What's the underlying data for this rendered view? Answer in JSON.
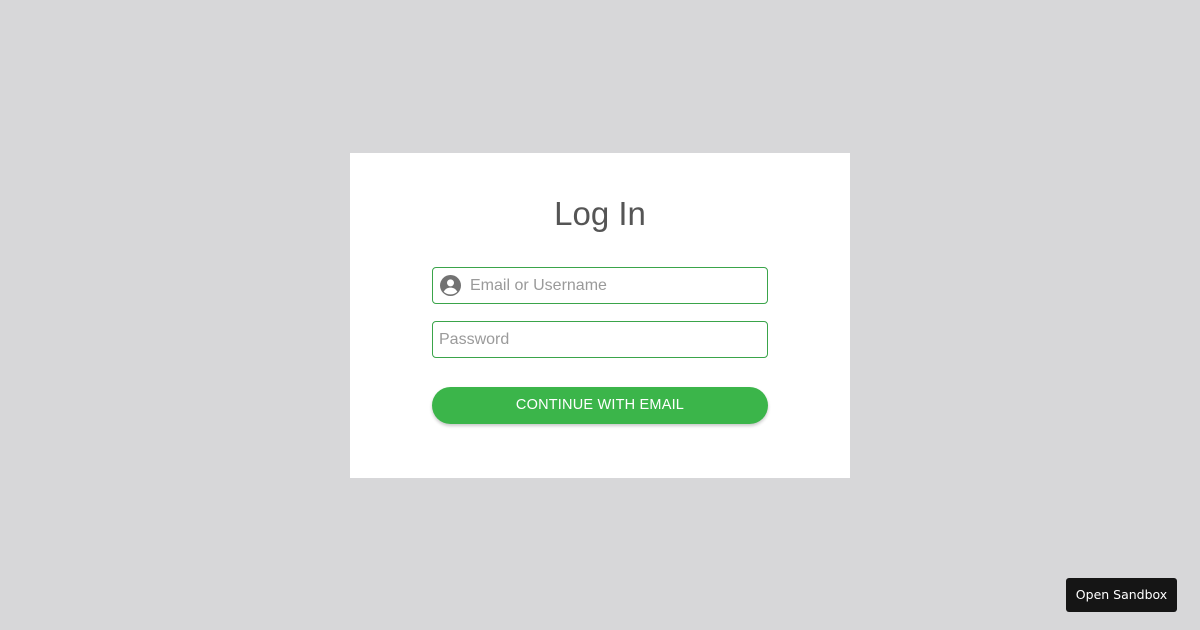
{
  "login": {
    "title": "Log In",
    "username_placeholder": "Email or Username",
    "username_value": "",
    "username_icon": "user-circle-icon",
    "password_placeholder": "Password",
    "password_value": "",
    "continue_label": "CONTINUE WITH EMAIL"
  },
  "sandbox": {
    "label": "Open Sandbox"
  },
  "colors": {
    "background": "#d7d7d9",
    "card": "#ffffff",
    "accent": "#3bb54a",
    "field_border": "#3aa44a",
    "title": "#555555",
    "sandbox_button": "#151515"
  }
}
